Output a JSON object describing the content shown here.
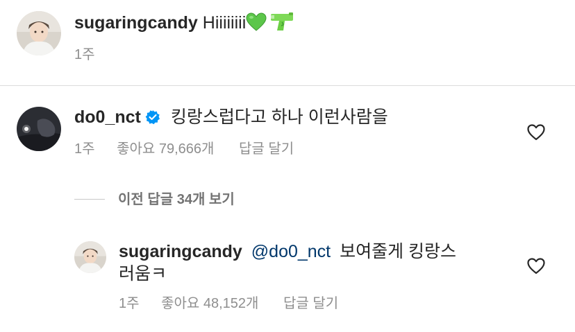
{
  "caption": {
    "username": "sugaringcandy",
    "text": "Hiiiiiiii",
    "emojis": [
      "green-heart",
      "water-pistol"
    ],
    "time": "1주"
  },
  "comment": {
    "username": "do0_nct",
    "verified": true,
    "text": "킹랑스럽다고 하나 이런사람을",
    "time": "1주",
    "likes": "좋아요 79,666개",
    "reply_label": "답글 달기"
  },
  "view_replies": "이전 답글 34개 보기",
  "reply": {
    "username": "sugaringcandy",
    "mention": "@do0_nct",
    "text_line1": "보여줄게 킹랑스",
    "text_line2": "러움ㅋ",
    "time": "1주",
    "likes": "좋아요 48,152개",
    "reply_label": "답글 달기"
  },
  "colors": {
    "text": "#262626",
    "secondary": "#8e8e8e",
    "mention": "#00376b",
    "verified": "#0095f6",
    "green_heart": "#5cc64a"
  }
}
